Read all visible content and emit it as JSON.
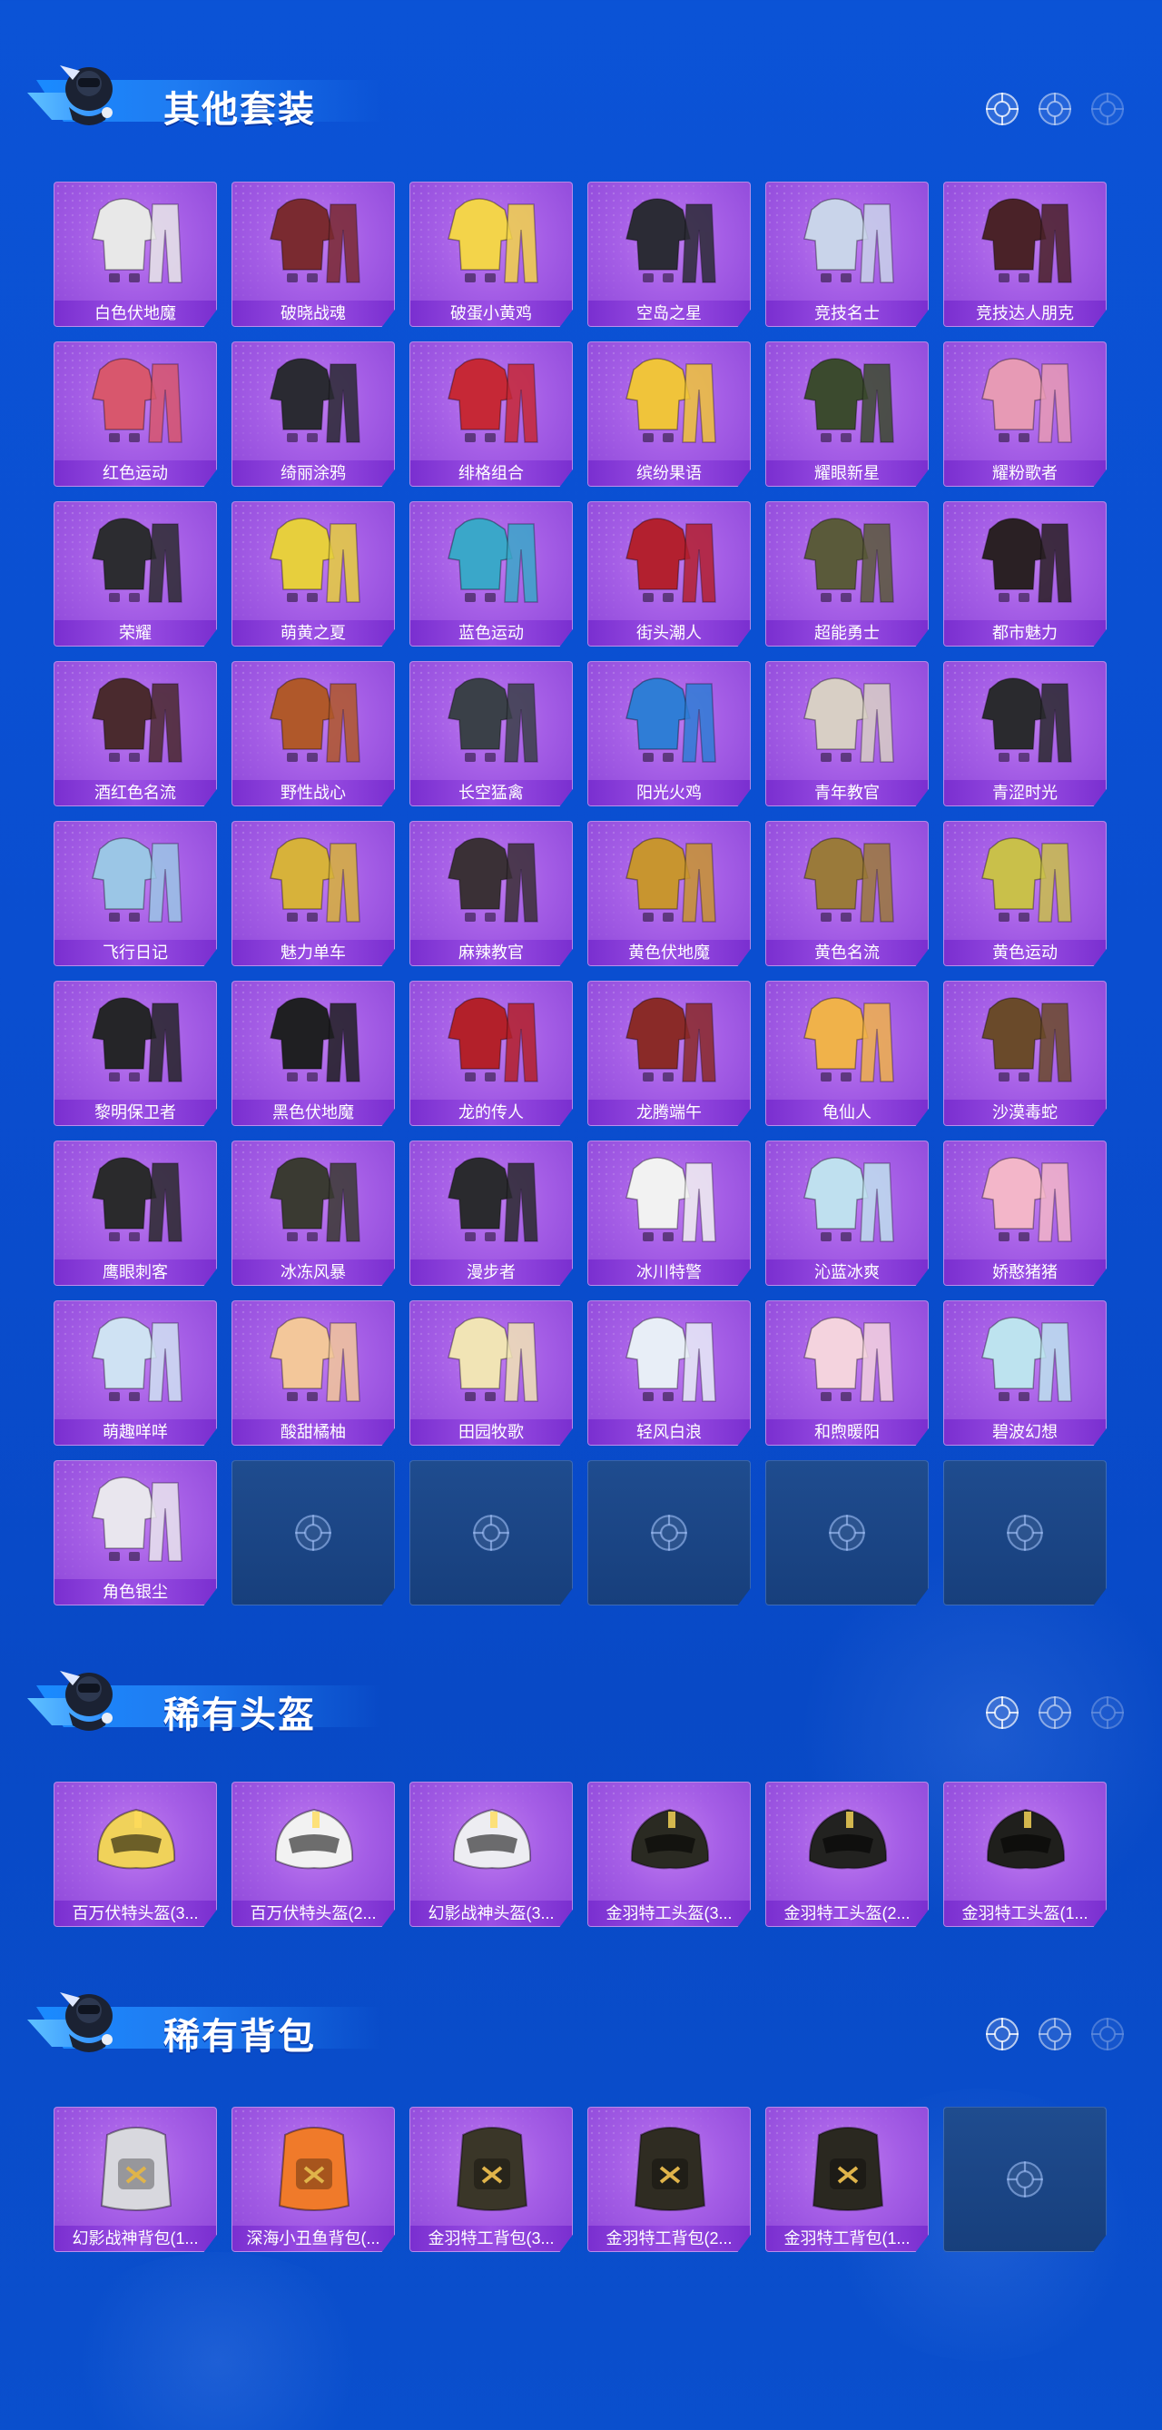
{
  "sections": {
    "suits": {
      "title": "其他套装",
      "items": [
        {
          "label": "白色伏地魔",
          "hue": "#e8e8e8"
        },
        {
          "label": "破晓战魂",
          "hue": "#7a2a30"
        },
        {
          "label": "破蛋小黄鸡",
          "hue": "#f3d44a"
        },
        {
          "label": "空岛之星",
          "hue": "#2b2b35"
        },
        {
          "label": "竞技名士",
          "hue": "#c9d4ea"
        },
        {
          "label": "竞技达人朋克",
          "hue": "#4a2228"
        },
        {
          "label": "红色运动",
          "hue": "#d8576d"
        },
        {
          "label": "绮丽涂鸦",
          "hue": "#2a2a32"
        },
        {
          "label": "绯格组合",
          "hue": "#c62836"
        },
        {
          "label": "缤纷果语",
          "hue": "#f0c43a"
        },
        {
          "label": "耀眼新星",
          "hue": "#3b4a2e"
        },
        {
          "label": "耀粉歌者",
          "hue": "#e79ab5"
        },
        {
          "label": "荣耀",
          "hue": "#2c2c30"
        },
        {
          "label": "萌黄之夏",
          "hue": "#e7cf3d"
        },
        {
          "label": "蓝色运动",
          "hue": "#3aa7c9"
        },
        {
          "label": "街头潮人",
          "hue": "#b3202f"
        },
        {
          "label": "超能勇士",
          "hue": "#5a5a3a"
        },
        {
          "label": "都市魅力",
          "hue": "#2a2024"
        },
        {
          "label": "酒红色名流",
          "hue": "#4a2a2e"
        },
        {
          "label": "野性战心",
          "hue": "#b0582a"
        },
        {
          "label": "长空猛禽",
          "hue": "#3a4048"
        },
        {
          "label": "阳光火鸡",
          "hue": "#2f7dd6"
        },
        {
          "label": "青年教官",
          "hue": "#d8cfc5"
        },
        {
          "label": "青涩时光",
          "hue": "#2a2a2e"
        },
        {
          "label": "飞行日记",
          "hue": "#9bc6e6"
        },
        {
          "label": "魅力单车",
          "hue": "#d7b23a"
        },
        {
          "label": "麻辣教官",
          "hue": "#3a3036"
        },
        {
          "label": "黄色伏地魔",
          "hue": "#c8952f"
        },
        {
          "label": "黄色名流",
          "hue": "#9a7a3a"
        },
        {
          "label": "黄色运动",
          "hue": "#c9c04a"
        },
        {
          "label": "黎明保卫者",
          "hue": "#252528"
        },
        {
          "label": "黑色伏地魔",
          "hue": "#1f1f22"
        },
        {
          "label": "龙的传人",
          "hue": "#b3202a"
        },
        {
          "label": "龙腾端午",
          "hue": "#8a2a28"
        },
        {
          "label": "龟仙人",
          "hue": "#f0b24a"
        },
        {
          "label": "沙漠毒蛇",
          "hue": "#6a4a2a"
        },
        {
          "label": "鹰眼刺客",
          "hue": "#2a2a2c"
        },
        {
          "label": "冰冻风暴",
          "hue": "#3a3a32"
        },
        {
          "label": "漫步者",
          "hue": "#2a2a2e"
        },
        {
          "label": "冰川特警",
          "hue": "#f2f2f2"
        },
        {
          "label": "沁蓝冰爽",
          "hue": "#bfe0ef"
        },
        {
          "label": "娇憨猪猪",
          "hue": "#f3b6c9"
        },
        {
          "label": "萌趣咩咩",
          "hue": "#cfe2f3"
        },
        {
          "label": "酸甜橘柚",
          "hue": "#f3c79a"
        },
        {
          "label": "田园牧歌",
          "hue": "#f1e4b5"
        },
        {
          "label": "轻风白浪",
          "hue": "#e8eef7"
        },
        {
          "label": "和煦暖阳",
          "hue": "#f4d3de"
        },
        {
          "label": "碧波幻想",
          "hue": "#bde3ef"
        },
        {
          "label": "角色银尘",
          "hue": "#e9e6ee"
        }
      ],
      "empty_count": 5
    },
    "helmets": {
      "title": "稀有头盔",
      "items": [
        {
          "label": "百万伏特头盔(3...",
          "hue": "#f0d25a"
        },
        {
          "label": "百万伏特头盔(2...",
          "hue": "#f2f2f2"
        },
        {
          "label": "幻影战神头盔(3...",
          "hue": "#ededf2"
        },
        {
          "label": "金羽特工头盔(3...",
          "hue": "#2a2a22"
        },
        {
          "label": "金羽特工头盔(2...",
          "hue": "#222220"
        },
        {
          "label": "金羽特工头盔(1...",
          "hue": "#1f1f1c"
        }
      ],
      "empty_count": 0
    },
    "backpacks": {
      "title": "稀有背包",
      "items": [
        {
          "label": "幻影战神背包(1...",
          "hue": "#d8d8de"
        },
        {
          "label": "深海小丑鱼背包(...",
          "hue": "#f07a2a"
        },
        {
          "label": "金羽特工背包(3...",
          "hue": "#3a3628"
        },
        {
          "label": "金羽特工背包(2...",
          "hue": "#2f2c22"
        },
        {
          "label": "金羽特工背包(1...",
          "hue": "#2a2820"
        }
      ],
      "empty_count": 1
    }
  },
  "icons": {
    "reticle": "crosshair-reticle-icon",
    "mascot": "mascot-emblem-icon"
  },
  "colors": {
    "background": "#0b53d6",
    "card": "#a55ee6",
    "label_bar": "#7a2fd0",
    "empty_slot": "#1f4c8f"
  }
}
